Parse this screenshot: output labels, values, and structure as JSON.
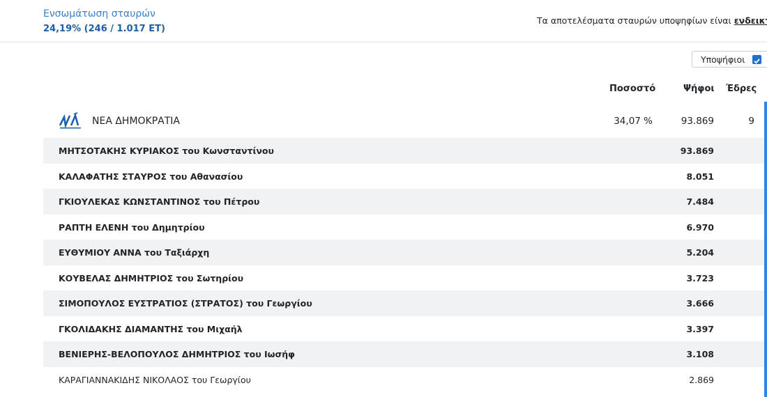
{
  "header": {
    "integration_label": "Ενσωμάτωση σταυρών",
    "integration_value": "24,19% (246 / 1.017 ΕΤ)",
    "notice_text": "Τα αποτελέσματα σταυρών υποψηφίων είναι ",
    "notice_link": "ενδεικτικά"
  },
  "toggle": {
    "label": "Υποψήφιοι",
    "checked": true
  },
  "columns": {
    "percent": "Ποσοστό",
    "votes": "Ψήφοι",
    "seats": "Έδρες"
  },
  "party": {
    "name": "ΝΕΑ ΔΗΜΟΚΡΑΤΙΑ",
    "logo_text": "νδ",
    "percent": "34,07 %",
    "votes": "93.869",
    "seats": "9"
  },
  "candidates": [
    {
      "name": "ΜΗΤΣΟΤΑΚΗΣ ΚΥΡΙΑΚΟΣ του Κωνσταντίνου",
      "votes": "93.869"
    },
    {
      "name": "ΚΑΛΑΦΑΤΗΣ ΣΤΑΥΡΟΣ του Αθανασίου",
      "votes": "8.051"
    },
    {
      "name": "ΓΚΙΟΥΛΕΚΑΣ ΚΩΝΣΤΑΝΤΙΝΟΣ του Πέτρου",
      "votes": "7.484"
    },
    {
      "name": "ΡΑΠΤΗ ΕΛΕΝΗ του Δημητρίου",
      "votes": "6.970"
    },
    {
      "name": "ΕΥΘΥΜΙΟΥ ΑΝΝΑ του Ταξιάρχη",
      "votes": "5.204"
    },
    {
      "name": "ΚΟΥΒΕΛΑΣ ΔΗΜΗΤΡΙΟΣ του Σωτηρίου",
      "votes": "3.723"
    },
    {
      "name": "ΣΙΜΟΠΟΥΛΟΣ ΕΥΣΤΡΑΤΙΟΣ (ΣΤΡΑΤΟΣ) του Γεωργίου",
      "votes": "3.666"
    },
    {
      "name": "ΓΚΟΛΙΔΑΚΗΣ ΔΙΑΜΑΝΤΗΣ του Μιχαήλ",
      "votes": "3.397"
    },
    {
      "name": "ΒΕΝΙΕΡΗΣ-ΒΕΛΟΠΟΥΛΟΣ ΔΗΜΗΤΡΙΟΣ του Ιωσήφ",
      "votes": "3.108"
    },
    {
      "name": "ΚΑΡΑΓΙΑΝΝΑΚΙΔΗΣ ΝΙΚΟΛΑΟΣ του Γεωργίου",
      "votes": "2.869"
    }
  ],
  "colors": {
    "accent": "#1f6fd1",
    "row_shade": "#f1f2f4",
    "header_blue": "#3c80c6"
  }
}
